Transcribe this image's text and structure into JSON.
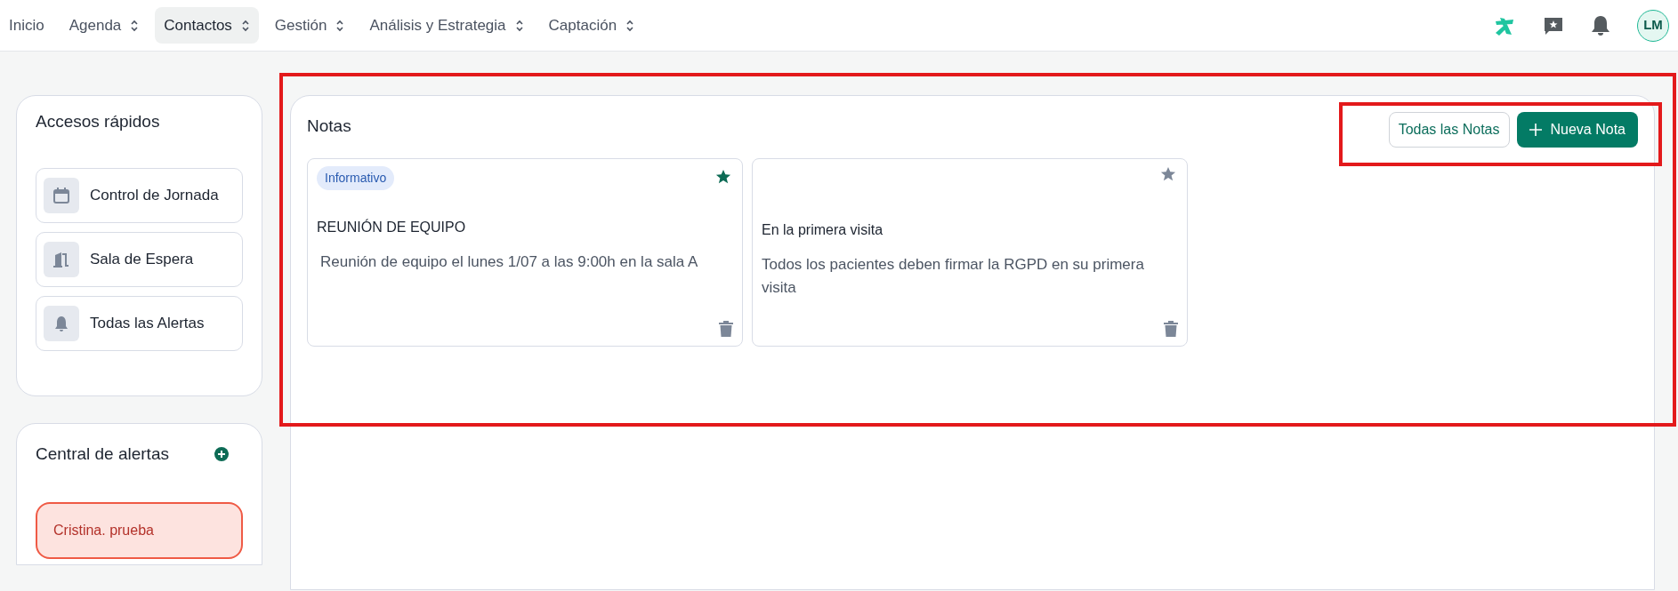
{
  "nav": {
    "items": [
      {
        "label": "Inicio",
        "selected": false,
        "dropdown": false
      },
      {
        "label": "Agenda",
        "selected": false,
        "dropdown": true
      },
      {
        "label": "Contactos",
        "selected": true,
        "dropdown": true
      },
      {
        "label": "Gestión",
        "selected": false,
        "dropdown": true
      },
      {
        "label": "Análisis y Estrategia",
        "selected": false,
        "dropdown": true
      },
      {
        "label": "Captación",
        "selected": false,
        "dropdown": true
      }
    ],
    "avatar": "LM"
  },
  "quick_access": {
    "title": "Accesos rápidos",
    "items": [
      {
        "label": "Control de Jornada",
        "kind": "calendar"
      },
      {
        "label": "Sala de Espera",
        "kind": "door"
      },
      {
        "label": "Todas las Alertas",
        "kind": "bell"
      }
    ]
  },
  "alerts": {
    "title": "Central de alertas",
    "items": [
      {
        "label": "Cristina. prueba",
        "color": "#ef5a45"
      }
    ]
  },
  "notes": {
    "title": "Notas",
    "buttons": [
      {
        "label": "Todas las Notas",
        "kind": "outline"
      },
      {
        "label": "Nueva Nota",
        "kind": "primary"
      }
    ],
    "cards": [
      {
        "tag": "Informativo",
        "starred": true,
        "title": "REUNIÓN DE EQUIPO",
        "body": "Reunión de equipo el lunes 1/07 a las 9:00h en la sala A"
      },
      {
        "starred": false,
        "title": "En la primera visita",
        "body": "Todos los pacientes deben firmar la RGPD en su primera visita"
      }
    ]
  }
}
